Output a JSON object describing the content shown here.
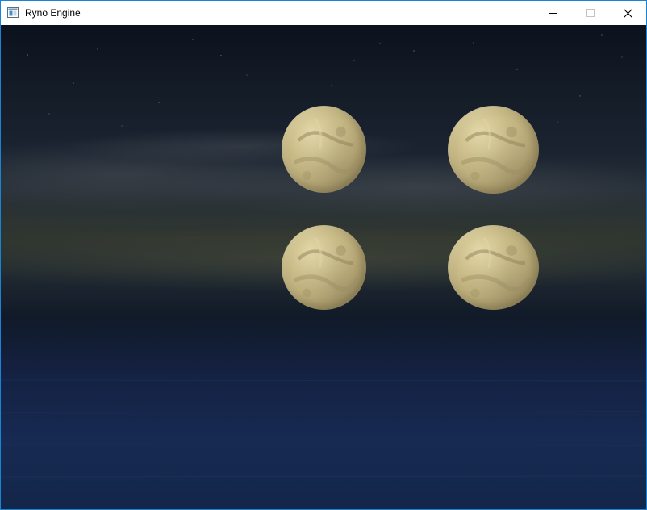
{
  "window": {
    "title": "Ryno Engine",
    "icon": "window-app-icon",
    "controls": [
      "minimize-icon",
      "maximize-icon",
      "close-icon"
    ]
  },
  "scene": {
    "background": "night-sky-over-ocean",
    "objects": [
      "moon-sphere",
      "moon-sphere",
      "moon-sphere",
      "moon-sphere"
    ]
  },
  "colors": {
    "window_border": "#1883d7",
    "sky_top": "#0b121d",
    "horizon": "#30362f",
    "ocean": "#172a52",
    "moon": "#c2b482"
  }
}
